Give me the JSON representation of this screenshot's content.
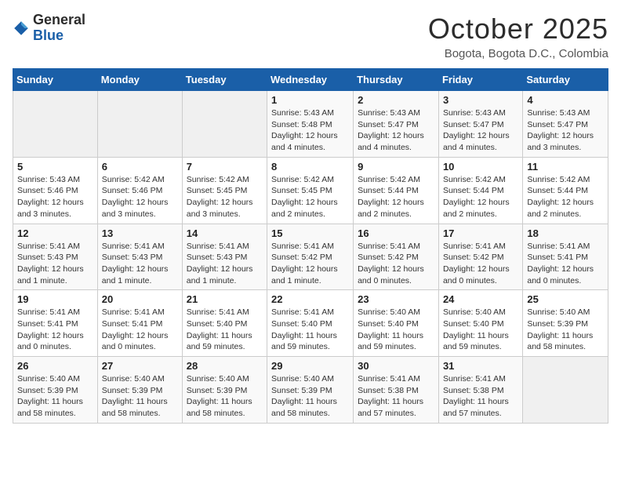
{
  "header": {
    "logo_general": "General",
    "logo_blue": "Blue",
    "title": "October 2025",
    "subtitle": "Bogota, Bogota D.C., Colombia"
  },
  "weekdays": [
    "Sunday",
    "Monday",
    "Tuesday",
    "Wednesday",
    "Thursday",
    "Friday",
    "Saturday"
  ],
  "weeks": [
    [
      {
        "day": "",
        "sunrise": "",
        "sunset": "",
        "daylight": ""
      },
      {
        "day": "",
        "sunrise": "",
        "sunset": "",
        "daylight": ""
      },
      {
        "day": "",
        "sunrise": "",
        "sunset": "",
        "daylight": ""
      },
      {
        "day": "1",
        "sunrise": "Sunrise: 5:43 AM",
        "sunset": "Sunset: 5:48 PM",
        "daylight": "Daylight: 12 hours and 4 minutes."
      },
      {
        "day": "2",
        "sunrise": "Sunrise: 5:43 AM",
        "sunset": "Sunset: 5:47 PM",
        "daylight": "Daylight: 12 hours and 4 minutes."
      },
      {
        "day": "3",
        "sunrise": "Sunrise: 5:43 AM",
        "sunset": "Sunset: 5:47 PM",
        "daylight": "Daylight: 12 hours and 4 minutes."
      },
      {
        "day": "4",
        "sunrise": "Sunrise: 5:43 AM",
        "sunset": "Sunset: 5:47 PM",
        "daylight": "Daylight: 12 hours and 3 minutes."
      }
    ],
    [
      {
        "day": "5",
        "sunrise": "Sunrise: 5:43 AM",
        "sunset": "Sunset: 5:46 PM",
        "daylight": "Daylight: 12 hours and 3 minutes."
      },
      {
        "day": "6",
        "sunrise": "Sunrise: 5:42 AM",
        "sunset": "Sunset: 5:46 PM",
        "daylight": "Daylight: 12 hours and 3 minutes."
      },
      {
        "day": "7",
        "sunrise": "Sunrise: 5:42 AM",
        "sunset": "Sunset: 5:45 PM",
        "daylight": "Daylight: 12 hours and 3 minutes."
      },
      {
        "day": "8",
        "sunrise": "Sunrise: 5:42 AM",
        "sunset": "Sunset: 5:45 PM",
        "daylight": "Daylight: 12 hours and 2 minutes."
      },
      {
        "day": "9",
        "sunrise": "Sunrise: 5:42 AM",
        "sunset": "Sunset: 5:44 PM",
        "daylight": "Daylight: 12 hours and 2 minutes."
      },
      {
        "day": "10",
        "sunrise": "Sunrise: 5:42 AM",
        "sunset": "Sunset: 5:44 PM",
        "daylight": "Daylight: 12 hours and 2 minutes."
      },
      {
        "day": "11",
        "sunrise": "Sunrise: 5:42 AM",
        "sunset": "Sunset: 5:44 PM",
        "daylight": "Daylight: 12 hours and 2 minutes."
      }
    ],
    [
      {
        "day": "12",
        "sunrise": "Sunrise: 5:41 AM",
        "sunset": "Sunset: 5:43 PM",
        "daylight": "Daylight: 12 hours and 1 minute."
      },
      {
        "day": "13",
        "sunrise": "Sunrise: 5:41 AM",
        "sunset": "Sunset: 5:43 PM",
        "daylight": "Daylight: 12 hours and 1 minute."
      },
      {
        "day": "14",
        "sunrise": "Sunrise: 5:41 AM",
        "sunset": "Sunset: 5:43 PM",
        "daylight": "Daylight: 12 hours and 1 minute."
      },
      {
        "day": "15",
        "sunrise": "Sunrise: 5:41 AM",
        "sunset": "Sunset: 5:42 PM",
        "daylight": "Daylight: 12 hours and 1 minute."
      },
      {
        "day": "16",
        "sunrise": "Sunrise: 5:41 AM",
        "sunset": "Sunset: 5:42 PM",
        "daylight": "Daylight: 12 hours and 0 minutes."
      },
      {
        "day": "17",
        "sunrise": "Sunrise: 5:41 AM",
        "sunset": "Sunset: 5:42 PM",
        "daylight": "Daylight: 12 hours and 0 minutes."
      },
      {
        "day": "18",
        "sunrise": "Sunrise: 5:41 AM",
        "sunset": "Sunset: 5:41 PM",
        "daylight": "Daylight: 12 hours and 0 minutes."
      }
    ],
    [
      {
        "day": "19",
        "sunrise": "Sunrise: 5:41 AM",
        "sunset": "Sunset: 5:41 PM",
        "daylight": "Daylight: 12 hours and 0 minutes."
      },
      {
        "day": "20",
        "sunrise": "Sunrise: 5:41 AM",
        "sunset": "Sunset: 5:41 PM",
        "daylight": "Daylight: 12 hours and 0 minutes."
      },
      {
        "day": "21",
        "sunrise": "Sunrise: 5:41 AM",
        "sunset": "Sunset: 5:40 PM",
        "daylight": "Daylight: 11 hours and 59 minutes."
      },
      {
        "day": "22",
        "sunrise": "Sunrise: 5:41 AM",
        "sunset": "Sunset: 5:40 PM",
        "daylight": "Daylight: 11 hours and 59 minutes."
      },
      {
        "day": "23",
        "sunrise": "Sunrise: 5:40 AM",
        "sunset": "Sunset: 5:40 PM",
        "daylight": "Daylight: 11 hours and 59 minutes."
      },
      {
        "day": "24",
        "sunrise": "Sunrise: 5:40 AM",
        "sunset": "Sunset: 5:40 PM",
        "daylight": "Daylight: 11 hours and 59 minutes."
      },
      {
        "day": "25",
        "sunrise": "Sunrise: 5:40 AM",
        "sunset": "Sunset: 5:39 PM",
        "daylight": "Daylight: 11 hours and 58 minutes."
      }
    ],
    [
      {
        "day": "26",
        "sunrise": "Sunrise: 5:40 AM",
        "sunset": "Sunset: 5:39 PM",
        "daylight": "Daylight: 11 hours and 58 minutes."
      },
      {
        "day": "27",
        "sunrise": "Sunrise: 5:40 AM",
        "sunset": "Sunset: 5:39 PM",
        "daylight": "Daylight: 11 hours and 58 minutes."
      },
      {
        "day": "28",
        "sunrise": "Sunrise: 5:40 AM",
        "sunset": "Sunset: 5:39 PM",
        "daylight": "Daylight: 11 hours and 58 minutes."
      },
      {
        "day": "29",
        "sunrise": "Sunrise: 5:40 AM",
        "sunset": "Sunset: 5:39 PM",
        "daylight": "Daylight: 11 hours and 58 minutes."
      },
      {
        "day": "30",
        "sunrise": "Sunrise: 5:41 AM",
        "sunset": "Sunset: 5:38 PM",
        "daylight": "Daylight: 11 hours and 57 minutes."
      },
      {
        "day": "31",
        "sunrise": "Sunrise: 5:41 AM",
        "sunset": "Sunset: 5:38 PM",
        "daylight": "Daylight: 11 hours and 57 minutes."
      },
      {
        "day": "",
        "sunrise": "",
        "sunset": "",
        "daylight": ""
      }
    ]
  ]
}
